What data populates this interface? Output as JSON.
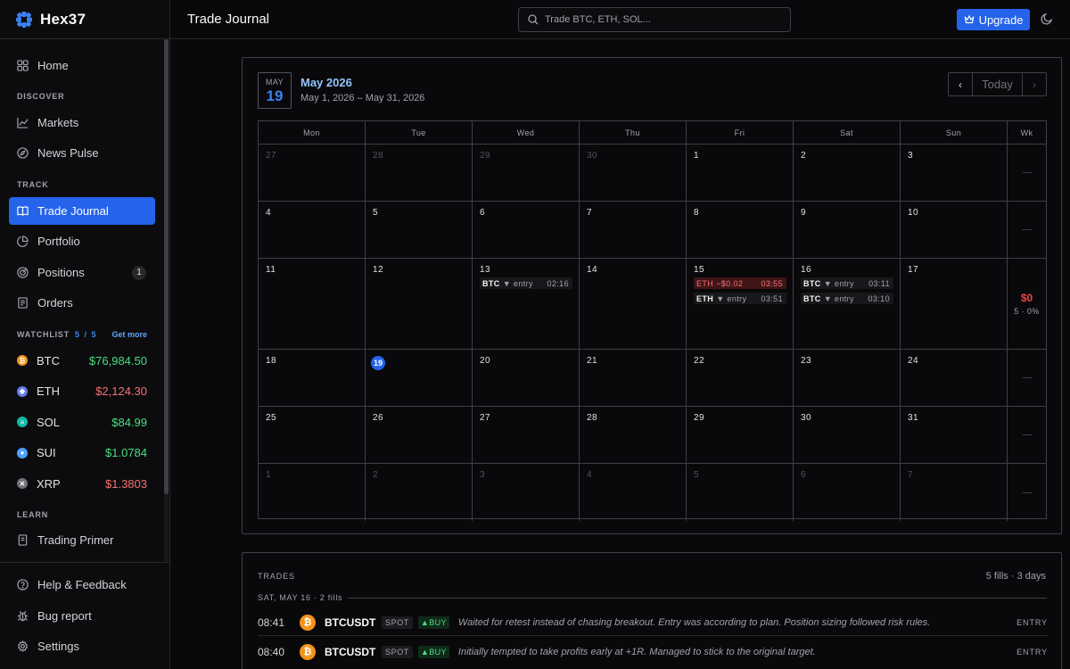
{
  "brand": {
    "name": "Hex37"
  },
  "sidebar": {
    "home": "Home",
    "sections": {
      "discover": "DISCOVER",
      "track": "TRACK",
      "learn": "LEARN"
    },
    "discover_items": [
      "Markets",
      "News Pulse"
    ],
    "track_items": [
      "Trade Journal",
      "Portfolio",
      "Positions",
      "Orders"
    ],
    "positions_badge": "1",
    "watchlist": {
      "label": "WATCHLIST",
      "count": "5 / 5",
      "get_more": "Get more",
      "items": [
        {
          "symbol": "BTC",
          "price": "$76,984.50",
          "direction": "up",
          "color": "#f7931a",
          "icon": "bitcoin-icon"
        },
        {
          "symbol": "ETH",
          "price": "$2,124.30",
          "direction": "down",
          "color": "#627eea",
          "icon": "ethereum-icon"
        },
        {
          "symbol": "SOL",
          "price": "$84.99",
          "direction": "up",
          "color": "#14b8a6",
          "icon": "solana-icon"
        },
        {
          "symbol": "SUI",
          "price": "$1.0784",
          "direction": "up",
          "color": "#4da2ff",
          "icon": "sui-icon"
        },
        {
          "symbol": "XRP",
          "price": "$1.3803",
          "direction": "down",
          "color": "#71717a",
          "icon": "xrp-icon"
        }
      ]
    },
    "learn_items": [
      "Trading Primer"
    ],
    "footer_items": [
      "Help & Feedback",
      "Bug report",
      "Settings"
    ]
  },
  "topbar": {
    "title": "Trade Journal",
    "search_placeholder": "Trade BTC, ETH, SOL...",
    "upgrade_label": "Upgrade"
  },
  "calendar": {
    "badge_month": "MAY",
    "badge_day": "19",
    "title": "May 2026",
    "range": "May 1, 2026 – May 31, 2026",
    "today_label": "Today",
    "prev_icon": "‹",
    "next_icon": "›",
    "weekdays": [
      "Mon",
      "Tue",
      "Wed",
      "Thu",
      "Fri",
      "Sat",
      "Sun",
      "Wk"
    ],
    "weeks": [
      {
        "days": [
          "27",
          "28",
          "29",
          "30",
          "1",
          "2",
          "3"
        ],
        "other": [
          true,
          true,
          true,
          true,
          false,
          false,
          false
        ],
        "wk": "—"
      },
      {
        "days": [
          "4",
          "5",
          "6",
          "7",
          "8",
          "9",
          "10"
        ],
        "other": [
          false,
          false,
          false,
          false,
          false,
          false,
          false
        ],
        "wk": "—"
      },
      {
        "days": [
          "11",
          "12",
          "13",
          "14",
          "15",
          "16",
          "17"
        ],
        "other": [
          false,
          false,
          false,
          false,
          false,
          false,
          false
        ],
        "wk_pnl": "$0",
        "wk_sub": "5 · 0%"
      },
      {
        "days": [
          "18",
          "19",
          "20",
          "21",
          "22",
          "23",
          "24"
        ],
        "other": [
          false,
          false,
          false,
          false,
          false,
          false,
          false
        ],
        "wk": "—"
      },
      {
        "days": [
          "25",
          "26",
          "27",
          "28",
          "29",
          "30",
          "31"
        ],
        "other": [
          false,
          false,
          false,
          false,
          false,
          false,
          false
        ],
        "wk": "—"
      },
      {
        "days": [
          "1",
          "2",
          "3",
          "4",
          "5",
          "6",
          "7"
        ],
        "other": [
          true,
          true,
          true,
          true,
          true,
          true,
          true
        ],
        "wk": "—"
      }
    ],
    "today_day": "19",
    "events": [
      {
        "week": 2,
        "col": 2,
        "slot": 0,
        "sym": "BTC",
        "action": "▼ entry",
        "time": "02:16",
        "loss": false
      },
      {
        "week": 2,
        "col": 4,
        "slot": 0,
        "sym": "ETH −$0.02",
        "action": "",
        "time": "03:55",
        "loss": true
      },
      {
        "week": 2,
        "col": 4,
        "slot": 1,
        "sym": "ETH",
        "action": "▼ entry",
        "time": "03:51",
        "loss": false
      },
      {
        "week": 2,
        "col": 5,
        "slot": 0,
        "sym": "BTC",
        "action": "▼ entry",
        "time": "03:11",
        "loss": false
      },
      {
        "week": 2,
        "col": 5,
        "slot": 1,
        "sym": "BTC",
        "action": "▼ entry",
        "time": "03:10",
        "loss": false
      }
    ]
  },
  "trades": {
    "label": "TRADES",
    "summary": "5 fills · 3 days",
    "group_label": "SAT, MAY 16  · 2 fills",
    "rows": [
      {
        "time": "08:41",
        "symbol": "BTCUSDT",
        "type": "SPOT",
        "side": "▲BUY",
        "note": "Waited for retest instead of chasing breakout. Entry was according to plan. Position sizing followed risk rules.",
        "kind": "ENTRY"
      },
      {
        "time": "08:40",
        "symbol": "BTCUSDT",
        "type": "SPOT",
        "side": "▲BUY",
        "note": "Initially tempted to take profits early at +1R. Managed to stick to the original target.",
        "kind": "ENTRY"
      }
    ]
  }
}
